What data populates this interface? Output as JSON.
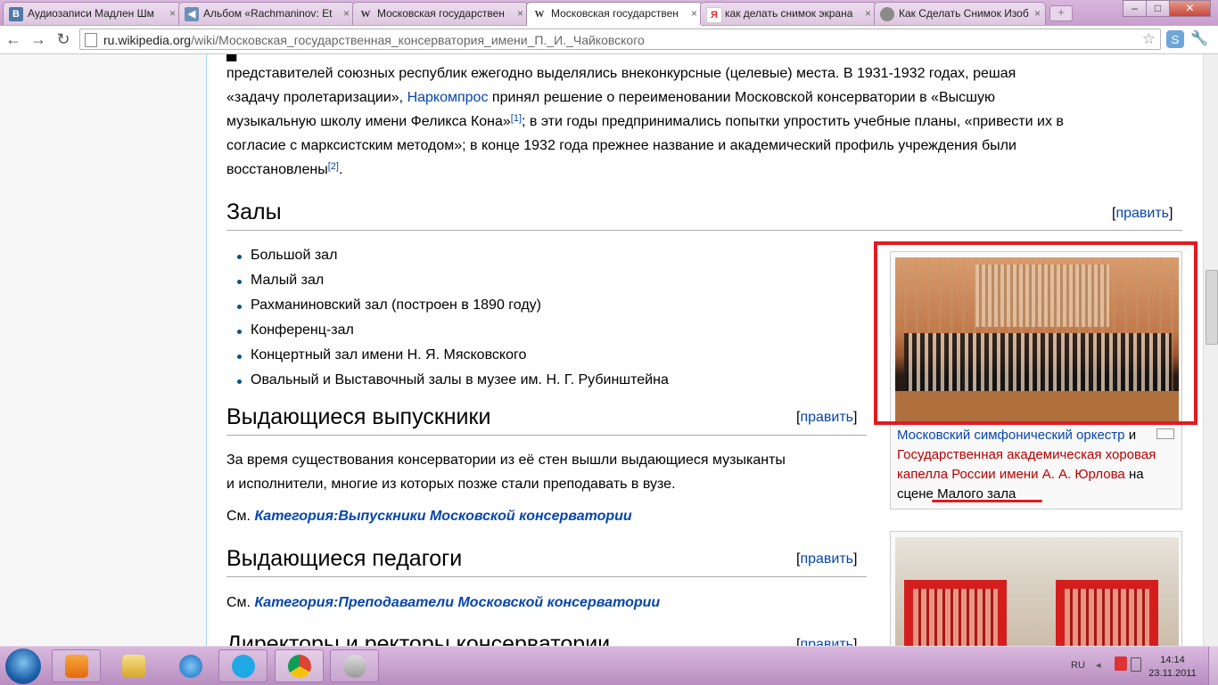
{
  "browser": {
    "tabs": [
      {
        "title": "Аудиозаписи Мадлен Шм",
        "favicon": "vk-icon",
        "color": "#4e78a8"
      },
      {
        "title": "Альбом «Rachmaninov: Et",
        "favicon": "speaker-icon",
        "color": "#6b8fb8"
      },
      {
        "title": "Московская государствен",
        "favicon": "wikipedia-icon",
        "color": "#555555"
      },
      {
        "title": "Московская государствен",
        "favicon": "wikipedia-icon",
        "color": "#555555",
        "active": true
      },
      {
        "title": "как делать снимок экрана",
        "favicon": "yandex-icon",
        "color": "#e32b2b"
      },
      {
        "title": "Как Сделать Снимок Изоб",
        "favicon": "globe-icon",
        "color": "#7a7a7a"
      }
    ],
    "favicon_glyphs": {
      "vk": "В",
      "wiki": "W",
      "yandex": "Я"
    },
    "url_host": "ru.wikipedia.org",
    "url_path": "/wiki/Московская_государственная_консерватория_имени_П._И._Чайковского"
  },
  "article": {
    "intro_lines": [
      "представителей союзных республик ежегодно выделялись внеконкурсные (целевые) места. В 1931-1932 годах, решая",
      "«задачу пролетаризации»,",
      "Наркомпрос",
      "принял решение о переименовании Московской консерватории в «Высшую",
      "музыкальную школу имени Феликса Кона»",
      "[1]",
      "; в эти годы предпринимались попытки упростить учебные планы, «привести их в",
      "согласие с марксистским методом»; в конце 1932 года прежнее название и академический профиль учреждения были",
      "восстановлены",
      "[2]",
      "."
    ],
    "edit_open": "[",
    "edit_label": "править",
    "edit_close": "]",
    "sections": {
      "halls": {
        "title": "Залы",
        "items": [
          {
            "label": "Большой зал",
            "link": true
          },
          {
            "label": "Малый зал",
            "link": false
          },
          {
            "label": "Рахманиновский зал (построен в 1890 году)",
            "link": false
          },
          {
            "label": "Конференц-зал",
            "link": false
          },
          {
            "label": "Концертный зал имени Н. Я. Мясковского",
            "link": false
          },
          {
            "label": "Овальный и Выставочный залы в музее им. Н. Г. Рубинштейна",
            "link": false
          }
        ]
      },
      "graduates": {
        "title": "Выдающиеся выпускники",
        "text_line1": "За время существования консерватории из её стен вышли выдающиеся музыканты",
        "text_line2": "и исполнители, многие из которых позже стали преподавать в вузе.",
        "see_prefix": "См.",
        "see_link": "Категория:Выпускники Московской консерватории"
      },
      "teachers": {
        "title": "Выдающиеся педагоги",
        "see_prefix": "См.",
        "see_link": "Категория:Преподаватели Московской консерватории"
      },
      "directors": {
        "title": "Директоры и ректоры консерватории"
      }
    },
    "thumbnail": {
      "caption_link1": "Московский симфонический оркестр",
      "caption_and": "и",
      "caption_link2a": "Государственная академическая хоровая",
      "caption_link2b": "капелла России имени А. А. Юрлова",
      "caption_on": "на",
      "caption_scene": "сцене",
      "caption_hall": "Малого зала"
    }
  },
  "taskbar": {
    "apps": [
      "media-player-icon",
      "file-explorer-icon",
      "internet-explorer-icon",
      "skype-icon",
      "chrome-icon",
      "audio-icon"
    ],
    "language": "RU",
    "time": "14:14",
    "date": "23.11.2011"
  },
  "colors": {
    "link": "#0645ad",
    "redlink": "#ba0000",
    "highlight": "#e21a22"
  }
}
